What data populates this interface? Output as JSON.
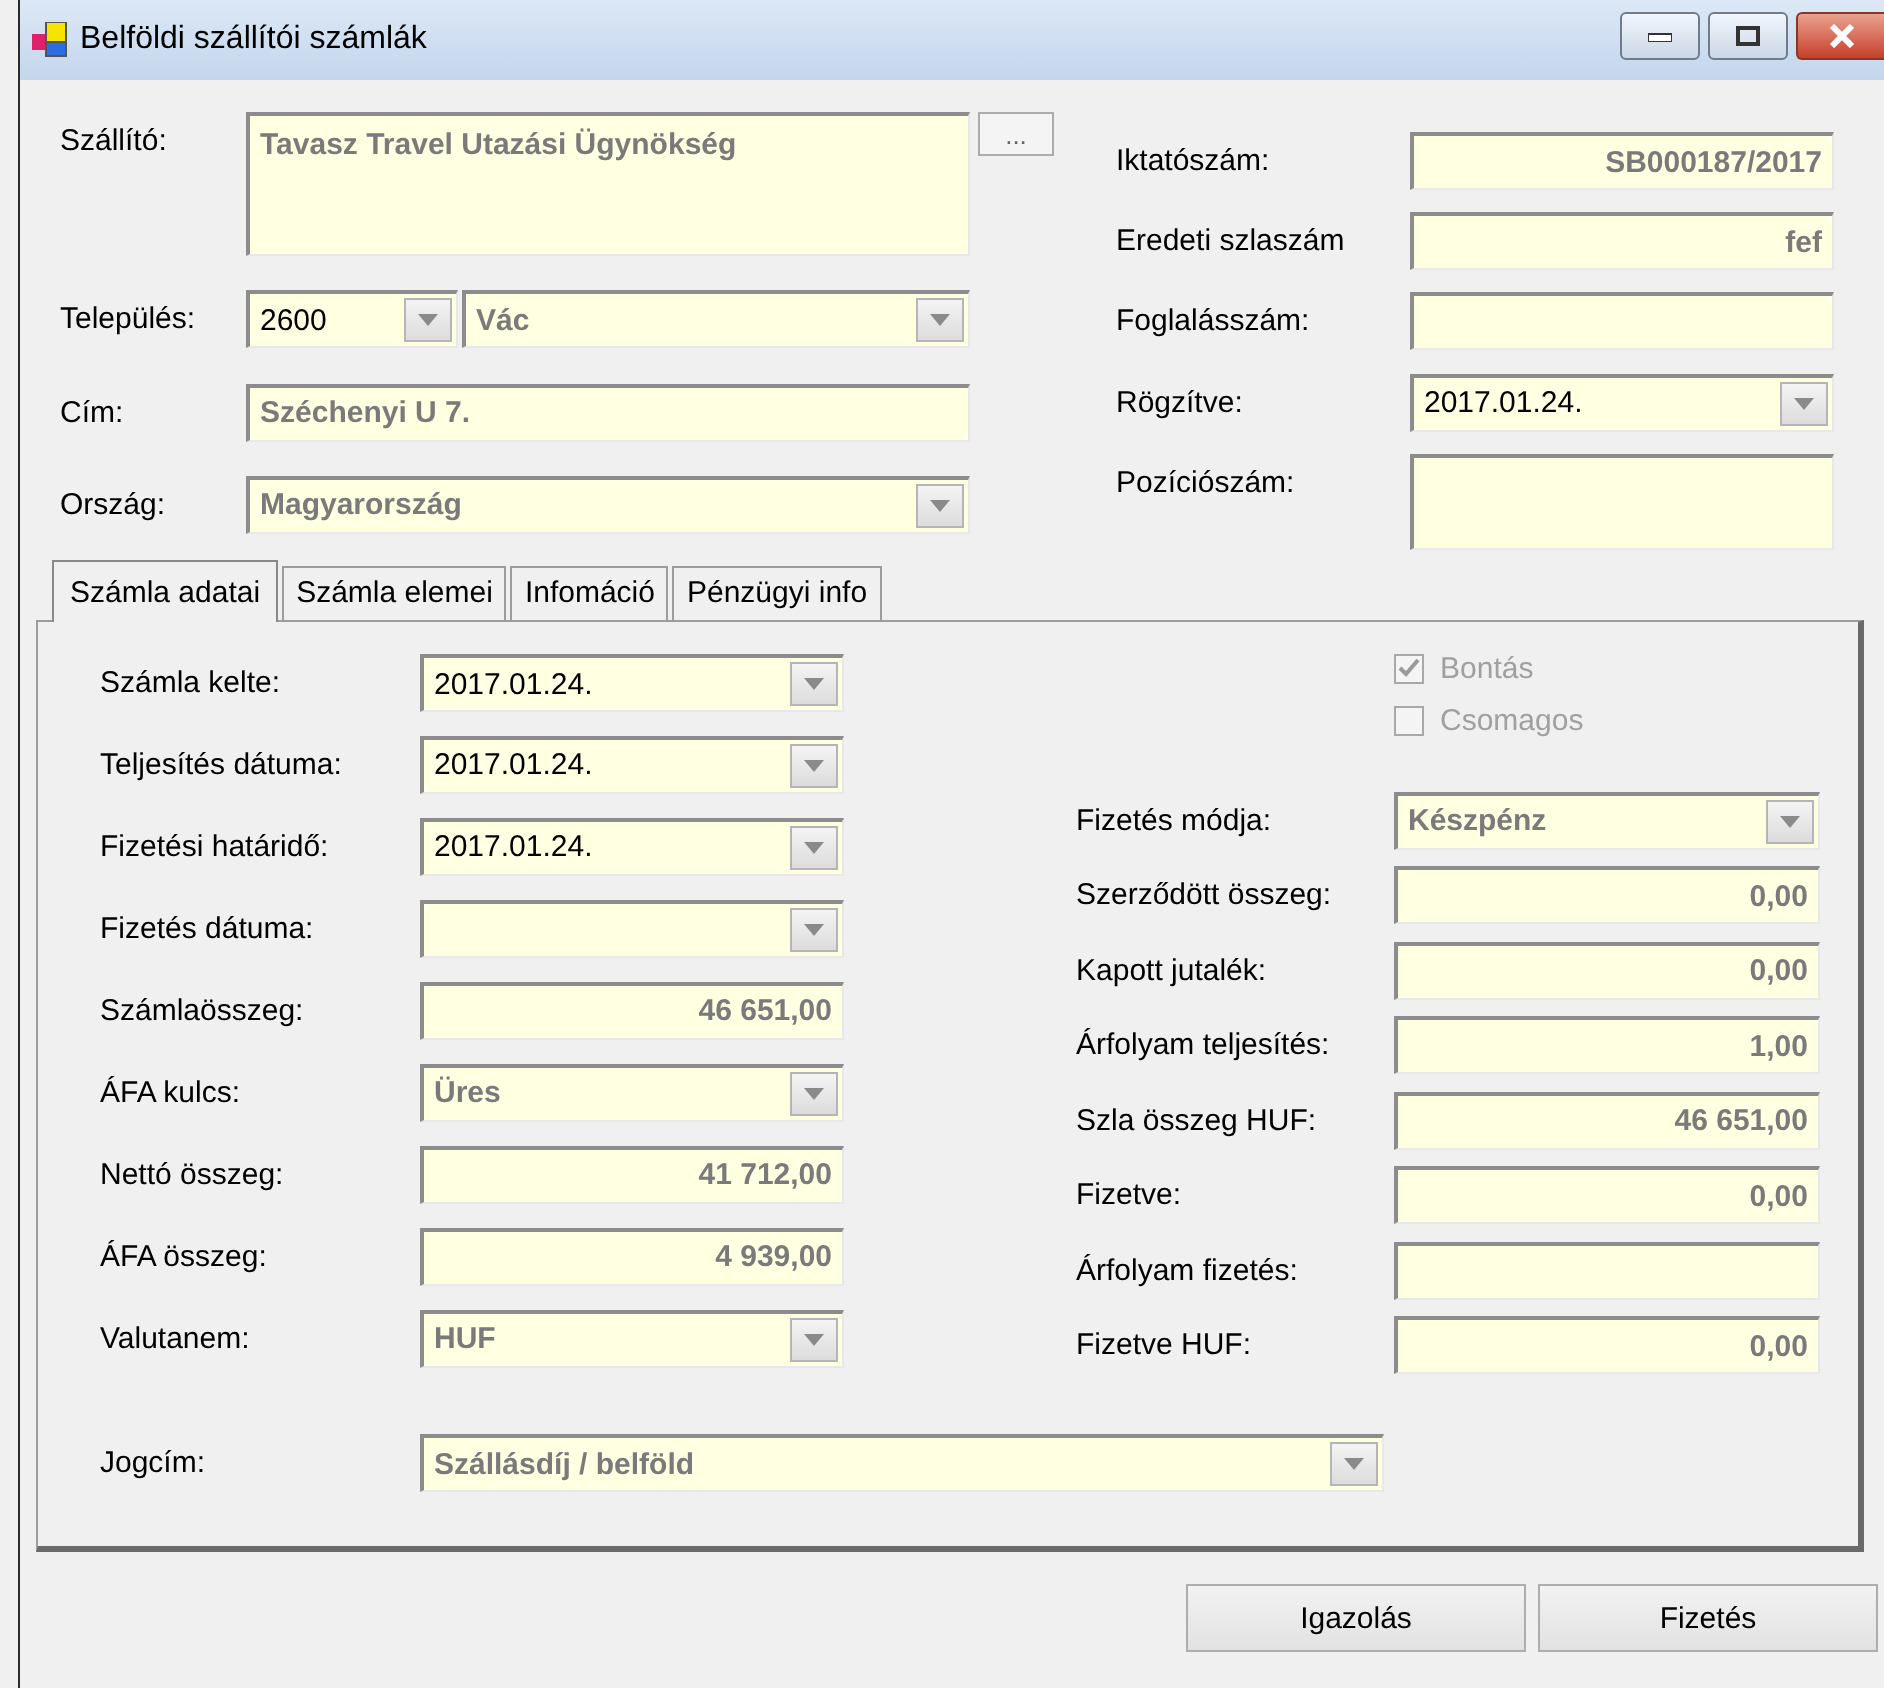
{
  "window": {
    "title": "Belföldi szállítói számlák"
  },
  "header_left": [
    {
      "label": "Szállító:",
      "kind": "memo",
      "parts": [
        {
          "value": "Tavasz Travel Utazási Ügynökség",
          "disabled": true
        }
      ],
      "browse": "..."
    },
    {
      "label": "Település:",
      "kind": "combo-pair",
      "parts": [
        {
          "value": "2600",
          "disabled": false
        },
        {
          "value": "Vác",
          "disabled": true
        }
      ]
    },
    {
      "label": "Cím:",
      "kind": "text",
      "parts": [
        {
          "value": "Széchenyi U 7.",
          "disabled": true
        }
      ]
    },
    {
      "label": "Ország:",
      "kind": "combo",
      "parts": [
        {
          "value": "Magyarország",
          "disabled": true
        }
      ]
    }
  ],
  "header_right": [
    {
      "label": "Iktatószám:",
      "kind": "right",
      "value": "SB000187/2017",
      "disabled": true
    },
    {
      "label": "Eredeti szlaszám",
      "kind": "right",
      "value": "fef",
      "disabled": true
    },
    {
      "label": "Foglalásszám:",
      "kind": "text"
    },
    {
      "label": "Rögzítve:",
      "kind": "combo",
      "value": "2017.01.24.",
      "disabled": false
    },
    {
      "label": "Pozíciószám:",
      "kind": "memo"
    }
  ],
  "tabs": [
    {
      "label": "Számla adatai",
      "selected": true
    },
    {
      "label": "Számla elemei",
      "selected": false
    },
    {
      "label": "Infomáció",
      "selected": false
    },
    {
      "label": "Pénzügyi info",
      "selected": false
    }
  ],
  "left_fields": [
    {
      "label": "Számla kelte:",
      "kind": "combo",
      "value": "2017.01.24.",
      "disabled": false
    },
    {
      "label": "Teljesítés dátuma:",
      "kind": "combo",
      "value": "2017.01.24.",
      "disabled": false
    },
    {
      "label": "Fizetési határidő:",
      "kind": "combo",
      "value": "2017.01.24.",
      "disabled": false
    },
    {
      "label": "Fizetés dátuma:",
      "kind": "combo"
    },
    {
      "label": "Számlaösszeg:",
      "kind": "right",
      "value": "46 651,00",
      "disabled": true
    },
    {
      "label": "ÁFA kulcs:",
      "kind": "combo",
      "value": "Üres",
      "disabled": true
    },
    {
      "label": "Nettó összeg:",
      "kind": "right",
      "value": "41 712,00",
      "disabled": true
    },
    {
      "label": "ÁFA összeg:",
      "kind": "right",
      "value": "4 939,00",
      "disabled": true
    },
    {
      "label": "Valutanem:",
      "kind": "combo",
      "value": "HUF",
      "disabled": true
    }
  ],
  "checkboxes": [
    {
      "label": "Bontás",
      "checked": true,
      "disabled": true
    },
    {
      "label": "Csomagos",
      "checked": false,
      "disabled": true
    }
  ],
  "right_fields": [
    {
      "label": "Fizetés módja:",
      "kind": "combo",
      "value": "Készpénz",
      "disabled": true
    },
    {
      "label": "Szerződött összeg:",
      "kind": "right",
      "value": "0,00",
      "disabled": true
    },
    {
      "label": "Kapott jutalék:",
      "kind": "right",
      "value": "0,00",
      "disabled": true
    },
    {
      "label": "Árfolyam teljesítés:",
      "kind": "right",
      "value": "1,00",
      "disabled": true
    },
    {
      "label": "Szla összeg HUF:",
      "kind": "right",
      "value": "46 651,00",
      "disabled": true
    },
    {
      "label": "Fizetve:",
      "kind": "right",
      "value": "0,00",
      "disabled": true
    },
    {
      "label": "Árfolyam fizetés:",
      "kind": "text"
    },
    {
      "label": "Fizetve HUF:",
      "kind": "right",
      "value": "0,00",
      "disabled": true
    }
  ],
  "jogcim": {
    "label": "Jogcím:",
    "kind": "combo",
    "value": "Szállásdíj / belföld",
    "disabled": true
  },
  "buttons": [
    "Igazolás",
    "Fizetés"
  ]
}
